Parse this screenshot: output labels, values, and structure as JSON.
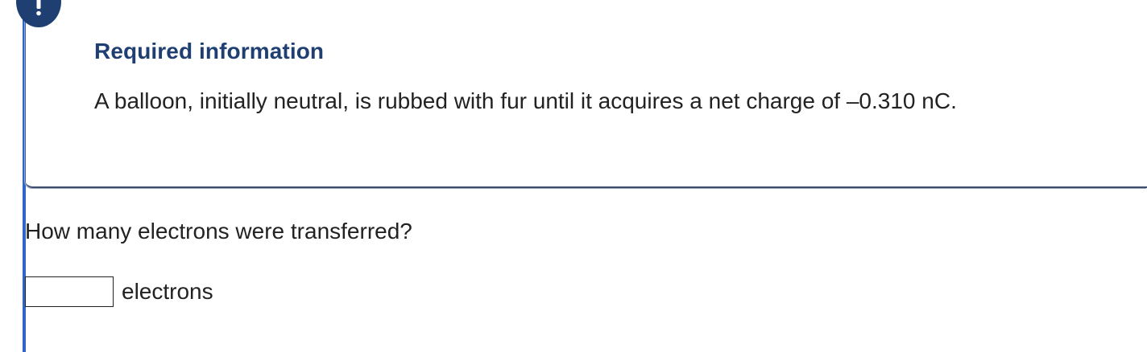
{
  "alert": {
    "icon": "exclamation-icon",
    "badge_color": "#1f3f73",
    "accent_color": "#2f64c8"
  },
  "info": {
    "title": "Required information",
    "text": "A balloon, initially neutral, is rubbed with fur until it acquires a net charge of –0.310 nC."
  },
  "question": {
    "prompt": "How many electrons were transferred?",
    "answer_value": "",
    "unit": "electrons"
  }
}
